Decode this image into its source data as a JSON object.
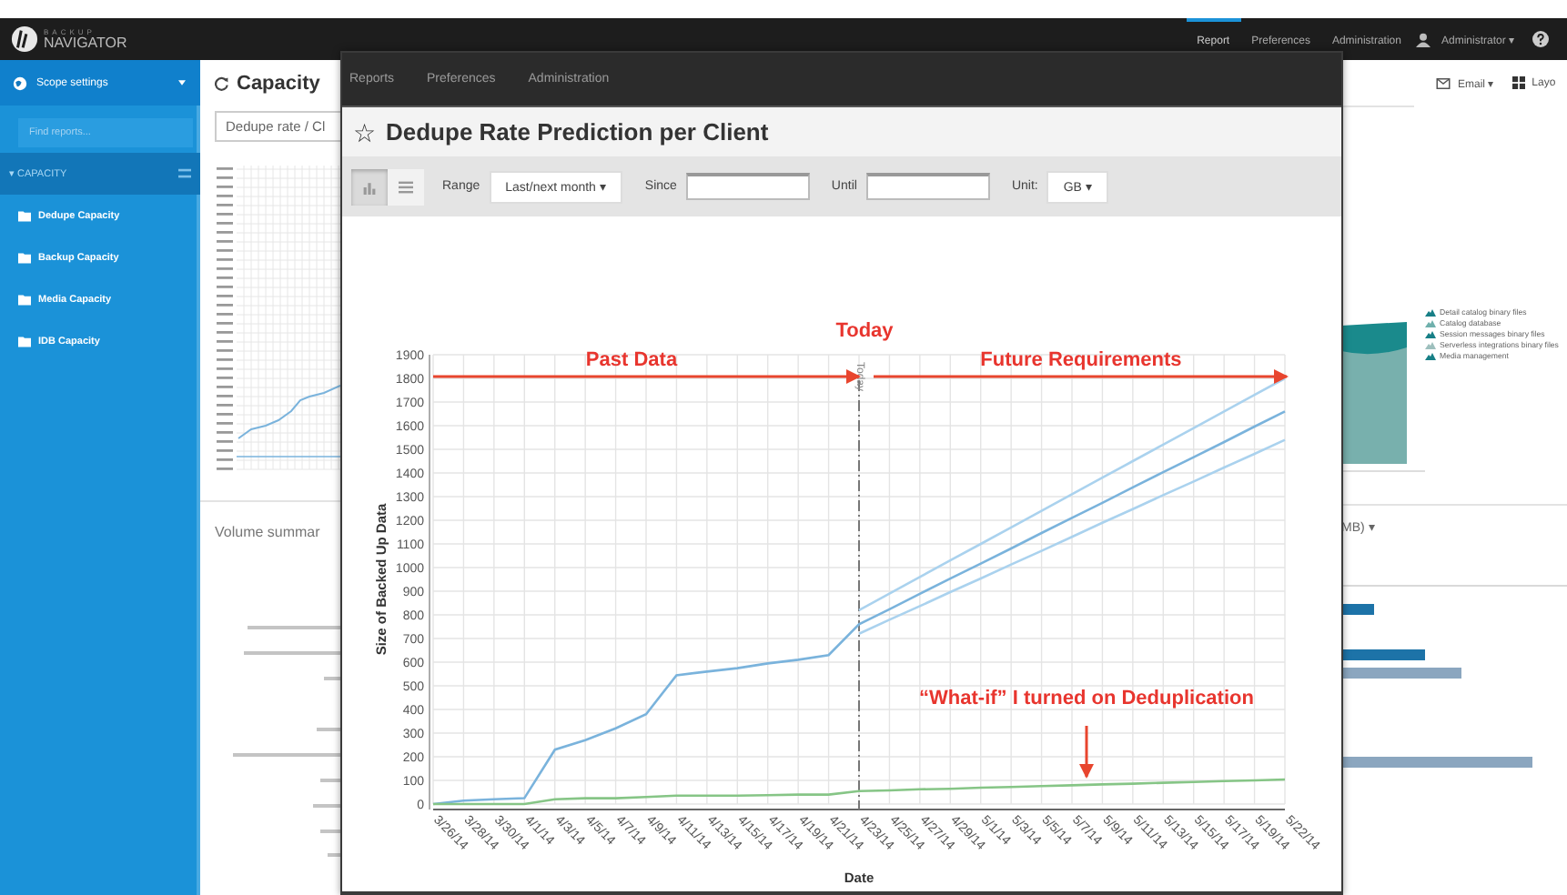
{
  "top_bar": {
    "logo": {
      "top": "BACKUP",
      "bottom": "NAVIGATOR"
    },
    "nav": [
      {
        "label": "Report",
        "selected": true
      },
      {
        "label": "Preferences",
        "selected": false
      },
      {
        "label": "Administration",
        "selected": false
      }
    ],
    "user": "Administrator ▾"
  },
  "sidebar": {
    "scope": "Scope settings",
    "search": {
      "placeholder": "Find reports..."
    },
    "section": "▾ CAPACITY",
    "items": [
      {
        "label": "Dedupe Capacity"
      },
      {
        "label": "Backup Capacity"
      },
      {
        "label": "Media Capacity"
      },
      {
        "label": "IDB Capacity"
      }
    ]
  },
  "page": {
    "title": "Capacity",
    "filter_value": "Dedupe rate / Cl",
    "section_title": "Volume summar",
    "email": "Email ▾",
    "layout": "Layo",
    "unit_title": "MB) ▾",
    "legend": [
      {
        "label": "Detail catalog binary files",
        "color": "#177f86"
      },
      {
        "label": "Catalog database",
        "color": "#6fb0ac"
      },
      {
        "label": "Session messages binary files",
        "color": "#177f86"
      },
      {
        "label": "Serverless integrations binary files",
        "color": "#9dbfbd"
      },
      {
        "label": "Media management",
        "color": "#177f86"
      }
    ]
  },
  "dialog": {
    "menu": [
      "Reports",
      "Preferences",
      "Administration"
    ],
    "star": "☆",
    "title": "Dedupe Rate Prediction per Client",
    "view_buttons": [
      {
        "kind": "chart",
        "selected": true
      },
      {
        "kind": "table",
        "selected": false
      }
    ],
    "range": {
      "label": "Range",
      "value": "Last/next month ▾"
    },
    "since": {
      "label": "Since"
    },
    "until": {
      "label": "Until"
    },
    "unit": {
      "label": "Unit:",
      "value": "GB ▾"
    },
    "chart_data": {
      "type": "line",
      "xlabel": "Date",
      "ylabel": "Size of Backed Up Data",
      "ylim": [
        0,
        1900
      ],
      "yticks": [
        0,
        100,
        200,
        300,
        400,
        500,
        600,
        700,
        800,
        900,
        1000,
        1100,
        1200,
        1300,
        1400,
        1500,
        1600,
        1700,
        1800,
        1900
      ],
      "x": [
        "3/26/14",
        "3/28/14",
        "3/30/14",
        "4/1/14",
        "4/3/14",
        "4/5/14",
        "4/7/14",
        "4/9/14",
        "4/11/14",
        "4/13/14",
        "4/15/14",
        "4/17/14",
        "4/19/14",
        "4/21/14",
        "4/23/14",
        "4/25/14",
        "4/27/14",
        "4/29/14",
        "5/1/14",
        "5/3/14",
        "5/5/14",
        "5/7/14",
        "5/9/14",
        "5/11/14",
        "5/13/14",
        "5/15/14",
        "5/17/14",
        "5/19/14",
        "5/22/14"
      ],
      "series": [
        {
          "color": "#7ab3dc",
          "values": [
            0,
            15,
            20,
            25,
            230,
            270,
            320,
            380,
            545,
            560,
            575,
            595,
            610,
            630,
            760,
            824,
            889,
            953,
            1017,
            1081,
            1146,
            1210,
            1274,
            1339,
            1403,
            1467,
            1531,
            1596,
            1660
          ]
        },
        {
          "color": "#aad2ee",
          "values": [
            null,
            null,
            null,
            null,
            null,
            null,
            null,
            null,
            null,
            null,
            null,
            null,
            null,
            null,
            820,
            890,
            960,
            1030,
            1100,
            1170,
            1240,
            1310,
            1380,
            1450,
            1520,
            1590,
            1660,
            1730,
            1800
          ]
        },
        {
          "color": "#aad2ee",
          "values": [
            null,
            null,
            null,
            null,
            null,
            null,
            null,
            null,
            null,
            null,
            null,
            null,
            null,
            null,
            720,
            779,
            837,
            896,
            954,
            1013,
            1071,
            1130,
            1189,
            1247,
            1306,
            1364,
            1423,
            1481,
            1540
          ]
        },
        {
          "color": "#86c586",
          "values": [
            0,
            0,
            0,
            0,
            20,
            25,
            25,
            30,
            35,
            35,
            35,
            38,
            40,
            40,
            55,
            58,
            62,
            65,
            69,
            72,
            76,
            79,
            83,
            86,
            90,
            93,
            97,
            100,
            104
          ]
        }
      ],
      "grid": true,
      "ref_lines": [
        {
          "axis": "x",
          "value": "4/23/14",
          "label": "Today"
        }
      ],
      "annotations": [
        {
          "text": "Past Data"
        },
        {
          "text": "Today"
        },
        {
          "text": "Future Requirements"
        },
        {
          "text": "“What-if” I turned on Deduplication"
        }
      ]
    }
  }
}
